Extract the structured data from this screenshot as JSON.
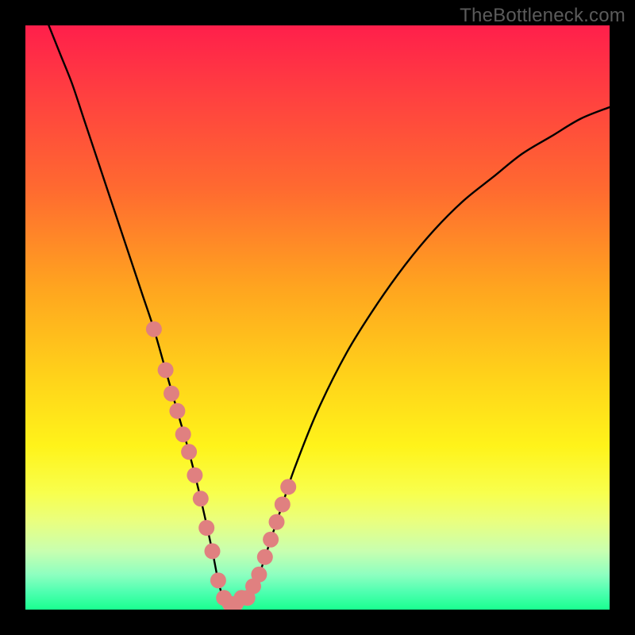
{
  "watermark": "TheBottleneck.com",
  "colors": {
    "frame": "#000000",
    "curve": "#000000",
    "marker_fill": "#e08080",
    "marker_stroke": "#c86a6a",
    "gradient_top": "#ff1f4b",
    "gradient_bottom": "#1aff90"
  },
  "chart_data": {
    "type": "line",
    "title": "",
    "xlabel": "",
    "ylabel": "",
    "xlim": [
      0,
      100
    ],
    "ylim": [
      0,
      100
    ],
    "series": [
      {
        "name": "curve",
        "x": [
          4,
          6,
          8,
          10,
          12,
          14,
          16,
          18,
          20,
          22,
          24,
          26,
          28,
          30,
          32,
          33,
          34,
          36,
          38,
          40,
          42,
          44,
          46,
          50,
          55,
          60,
          65,
          70,
          75,
          80,
          85,
          90,
          95,
          100
        ],
        "y": [
          100,
          95,
          90,
          84,
          78,
          72,
          66,
          60,
          54,
          48,
          41,
          34,
          27,
          19,
          10,
          5,
          2,
          1,
          2,
          6,
          12,
          18,
          24,
          34,
          44,
          52,
          59,
          65,
          70,
          74,
          78,
          81,
          84,
          86
        ]
      }
    ],
    "markers": {
      "name": "highlight-points",
      "x": [
        22,
        24,
        25,
        26,
        27,
        28,
        29,
        30,
        31,
        32,
        33,
        34,
        35,
        36,
        37,
        38,
        39,
        40,
        41,
        42,
        43,
        44,
        45
      ],
      "y": [
        48,
        41,
        37,
        34,
        30,
        27,
        23,
        19,
        14,
        10,
        5,
        2,
        1,
        1,
        2,
        2,
        4,
        6,
        9,
        12,
        15,
        18,
        21
      ]
    }
  }
}
